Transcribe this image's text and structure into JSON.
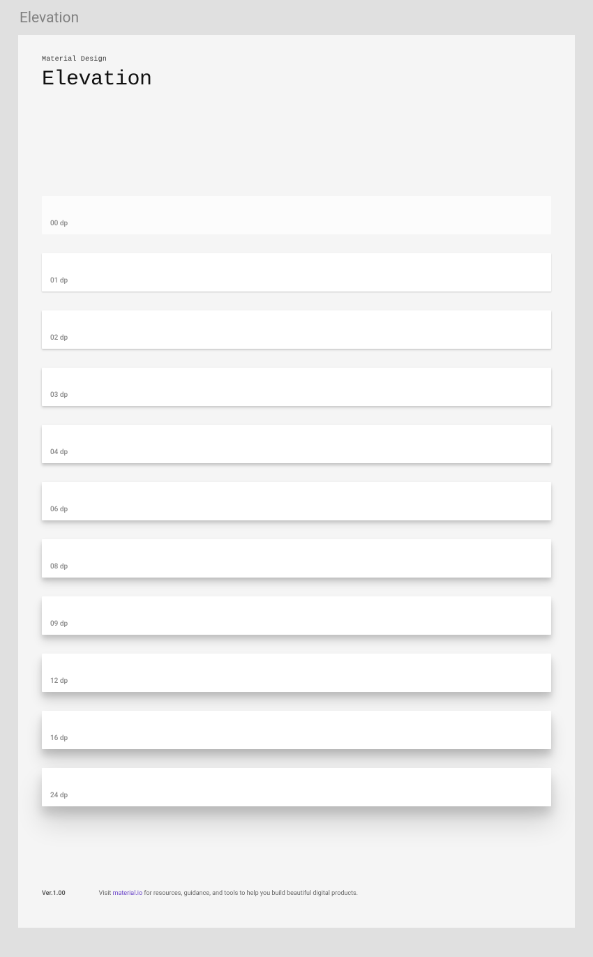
{
  "outer_title": "Elevation",
  "header": {
    "overline": "Material Design",
    "title": "Elevation"
  },
  "cards": [
    {
      "label": "00 dp",
      "css": "e00"
    },
    {
      "label": "01 dp",
      "css": "e01"
    },
    {
      "label": "02 dp",
      "css": "e02"
    },
    {
      "label": "03 dp",
      "css": "e03"
    },
    {
      "label": "04 dp",
      "css": "e04"
    },
    {
      "label": "06 dp",
      "css": "e06"
    },
    {
      "label": "08 dp",
      "css": "e08"
    },
    {
      "label": "09 dp",
      "css": "e09"
    },
    {
      "label": "12 dp",
      "css": "e12"
    },
    {
      "label": "16 dp",
      "css": "e16"
    },
    {
      "label": "24 dp",
      "css": "e24"
    }
  ],
  "footer": {
    "version": "Ver.1.00",
    "text_before": "Visit ",
    "link_text": "material.io",
    "text_after": " for resources, guidance, and tools to help you build beautiful digital products."
  }
}
